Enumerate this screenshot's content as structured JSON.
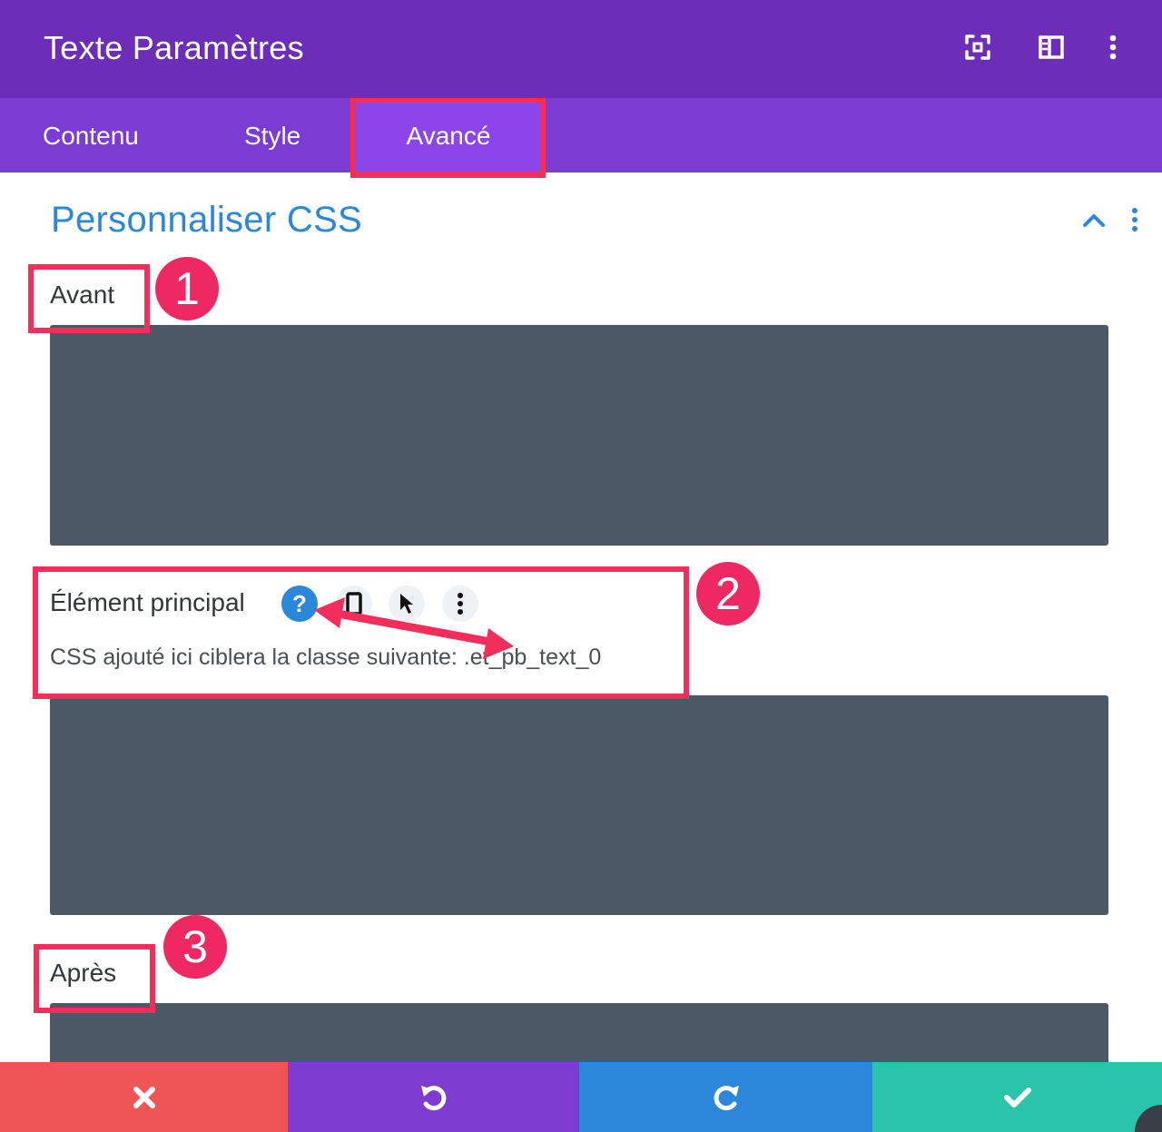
{
  "header": {
    "title": "Texte Paramètres",
    "icons": [
      "fullscreen-icon",
      "sidebar-layout-icon",
      "more-vertical-icon"
    ],
    "background": "#6c2eb9"
  },
  "tabs": [
    {
      "label": "Contenu",
      "active": false
    },
    {
      "label": "Style",
      "active": false
    },
    {
      "label": "Avancé",
      "active": true
    }
  ],
  "section": {
    "title": "Personnaliser CSS",
    "title_color": "#2b87da",
    "controls": [
      "chevron-up-icon",
      "more-vertical-icon"
    ]
  },
  "fields": {
    "avant": {
      "label": "Avant",
      "value": ""
    },
    "main_element": {
      "label": "Élément principal",
      "controls": [
        "help-icon",
        "mobile-icon",
        "cursor-icon",
        "more-vertical-icon"
      ],
      "help_text": "CSS ajouté ici ciblera la classe suivante: .et_pb_text_0",
      "value": ""
    },
    "apres": {
      "label": "Après",
      "value": ""
    }
  },
  "annotations": [
    "1",
    "2",
    "3"
  ],
  "footer": {
    "buttons": [
      {
        "name": "cancel",
        "icon": "close-icon",
        "color": "#ef5555"
      },
      {
        "name": "undo",
        "icon": "undo-icon",
        "color": "#7d3bcf"
      },
      {
        "name": "redo",
        "icon": "redo-icon",
        "color": "#2b87da"
      },
      {
        "name": "save",
        "icon": "checkmark-icon",
        "color": "#29c4a9"
      }
    ]
  },
  "colors": {
    "accent_purple": "#7b3cd4",
    "code_bg": "#4c5866",
    "annotation_pink": "#f42d5a"
  }
}
